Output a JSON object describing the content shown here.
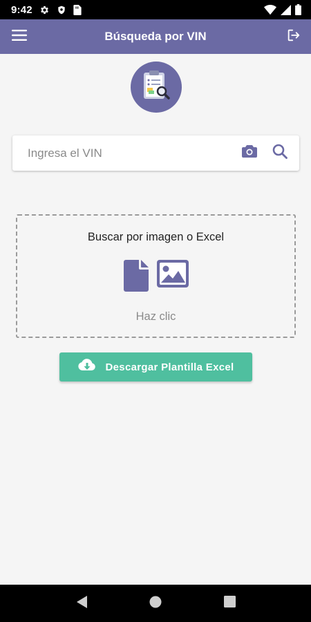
{
  "status_bar": {
    "time": "9:42",
    "left_icons": [
      "gear-icon",
      "shield-icon",
      "sim-card-icon"
    ],
    "right_icons": [
      "wifi-icon",
      "signal-icon",
      "battery-icon"
    ]
  },
  "app_bar": {
    "title": "Búsqueda por VIN",
    "menu_icon": "hamburger-menu-icon",
    "logout_icon": "logout-icon",
    "color": "#6b6aa4"
  },
  "logo": {
    "icon": "clipboard-search-icon"
  },
  "search": {
    "placeholder": "Ingresa el VIN",
    "value": "",
    "camera_icon": "camera-icon",
    "search_icon": "search-icon"
  },
  "upload": {
    "title": "Buscar por imagen o Excel",
    "hint": "Haz clic",
    "icons": [
      "file-icon",
      "image-icon"
    ]
  },
  "download_button": {
    "label": "Descargar Plantilla Excel",
    "icon": "cloud-download-icon",
    "color": "#4fbf9f"
  },
  "nav_bar": {
    "buttons": [
      "back-icon",
      "home-icon",
      "recents-icon"
    ]
  }
}
